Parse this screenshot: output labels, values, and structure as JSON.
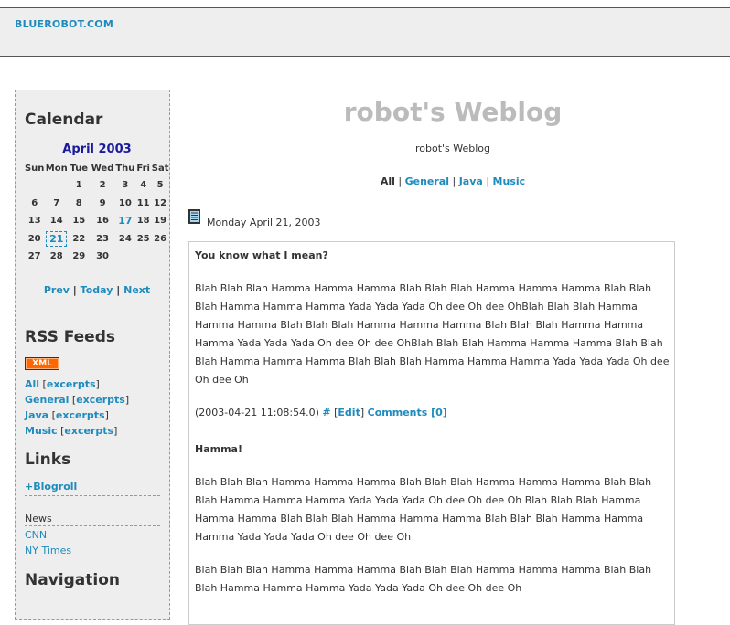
{
  "header": {
    "site_name": "BLUEROBOT.COM"
  },
  "sidebar": {
    "calendar_heading": "Calendar",
    "calendar_month": "April 2003",
    "weekdays": [
      "Sun",
      "Mon",
      "Tue",
      "Wed",
      "Thu",
      "Fri",
      "Sat"
    ],
    "weeks": [
      [
        "",
        "",
        "1",
        "2",
        "3",
        "4",
        "5"
      ],
      [
        "6",
        "7",
        "8",
        "9",
        "10",
        "11",
        "12"
      ],
      [
        "13",
        "14",
        "15",
        "16",
        "17",
        "18",
        "19"
      ],
      [
        "20",
        "21",
        "22",
        "23",
        "24",
        "25",
        "26"
      ],
      [
        "27",
        "28",
        "29",
        "30",
        "",
        "",
        ""
      ]
    ],
    "linked_days": [
      "17",
      "21"
    ],
    "today": "21",
    "cal_nav": {
      "prev": "Prev",
      "today": "Today",
      "next": "Next",
      "sep": "|"
    },
    "rss_heading": "RSS Feeds",
    "xml_badge": "XML",
    "feeds": [
      {
        "label": "All",
        "excerpts": "excerpts"
      },
      {
        "label": "General",
        "excerpts": "excerpts"
      },
      {
        "label": "Java",
        "excerpts": "excerpts"
      },
      {
        "label": "Music",
        "excerpts": "excerpts"
      }
    ],
    "links_heading": "Links",
    "blogroll": "+Blogroll",
    "news_label": "News",
    "news_links": [
      "CNN",
      "NY Times"
    ],
    "navigation_heading": "Navigation"
  },
  "main": {
    "blog_title": "robot's Weblog",
    "blog_description": "robot's Weblog",
    "categories": {
      "all": "All",
      "general": "General",
      "java": "Java",
      "music": "Music",
      "sep": "|"
    },
    "day_date": "Monday April 21, 2003",
    "entries": [
      {
        "title": "You know what I mean?",
        "body": "Blah Blah Blah Hamma Hamma Hamma Blah Blah Blah Hamma Hamma Hamma Blah Blah Blah Hamma Hamma Hamma Yada Yada Yada Oh dee Oh dee OhBlah Blah Blah Hamma Hamma Hamma Blah Blah Blah Hamma Hamma Hamma Blah Blah Blah Hamma Hamma Hamma Yada Yada Yada Oh dee Oh dee OhBlah Blah Blah Hamma Hamma Hamma Blah Blah Blah Hamma Hamma Hamma Blah Blah Blah Hamma Hamma Hamma Yada Yada Yada Oh dee Oh dee Oh",
        "timestamp": "(2003-04-21 11:08:54.0)",
        "permalink": "#",
        "edit": "Edit",
        "comments": "Comments [0]"
      },
      {
        "title": "Hamma!",
        "body": "Blah Blah Blah Hamma Hamma Hamma Blah Blah Blah Hamma Hamma Hamma Blah Blah Blah Hamma Hamma Hamma Yada Yada Yada Oh dee Oh dee Oh Blah Blah Blah Hamma Hamma Hamma Blah Blah Blah Hamma Hamma Hamma Blah Blah Blah Hamma Hamma Hamma Yada Yada Yada Oh dee Oh dee Oh",
        "body2": "Blah Blah Blah Hamma Hamma Hamma Blah Blah Blah Hamma Hamma Hamma Blah Blah Blah Hamma Hamma Hamma Yada Yada Yada Oh dee Oh dee Oh"
      }
    ]
  },
  "colors": {
    "link": "#1e8bbd",
    "month": "#1a1a9a",
    "title_gray": "#bbbbbb",
    "xml_orange": "#ff6600"
  }
}
